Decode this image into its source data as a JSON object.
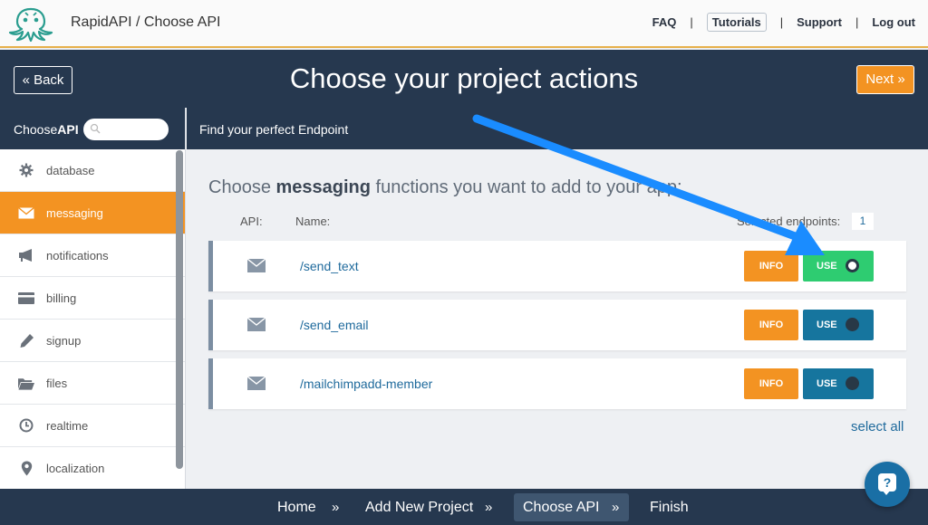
{
  "topbar": {
    "app_title": "RapidAPI / Choose API",
    "nav": [
      "FAQ",
      "Tutorials",
      "Support",
      "Log out"
    ],
    "separator": "|"
  },
  "header": {
    "back_label": "« Back",
    "title": "Choose your project actions",
    "next_label": "Next »"
  },
  "sidebar": {
    "title_plain": "Choose",
    "title_bold": "API",
    "search_placeholder": "",
    "items": [
      {
        "label": "database",
        "icon": "gear-icon",
        "active": false
      },
      {
        "label": "messaging",
        "icon": "envelope-icon",
        "active": true
      },
      {
        "label": "notifications",
        "icon": "megaphone-icon",
        "active": false
      },
      {
        "label": "billing",
        "icon": "credit-card-icon",
        "active": false
      },
      {
        "label": "signup",
        "icon": "pencil-icon",
        "active": false
      },
      {
        "label": "files",
        "icon": "folder-icon",
        "active": false
      },
      {
        "label": "realtime",
        "icon": "clock-icon",
        "active": false
      },
      {
        "label": "localization",
        "icon": "map-pin-icon",
        "active": false
      }
    ]
  },
  "main": {
    "subheader": "Find your perfect Endpoint",
    "heading_pre": "Choose ",
    "heading_bold": "messaging",
    "heading_post": " functions you want to add to your app:",
    "col_api": "API:",
    "col_name": "Name:",
    "selected_label": "Selected endpoints:",
    "selected_count": "1",
    "endpoints": [
      {
        "name": "/send_text",
        "info": "INFO",
        "use": "USE",
        "selected": true
      },
      {
        "name": "/send_email",
        "info": "INFO",
        "use": "USE",
        "selected": false
      },
      {
        "name": "/mailchimpadd-member",
        "info": "INFO",
        "use": "USE",
        "selected": false
      }
    ],
    "select_all": "select all"
  },
  "bottombar": {
    "steps": [
      "Home",
      "Add New Project",
      "Choose API",
      "Finish"
    ],
    "active_step": "Choose API",
    "separator": "»"
  },
  "help": {
    "label": "?"
  },
  "colors": {
    "navy": "#26384f",
    "orange": "#f39322",
    "blue": "#16759e",
    "green": "#2ecc71",
    "annotation_arrow": "#1a8cff"
  }
}
